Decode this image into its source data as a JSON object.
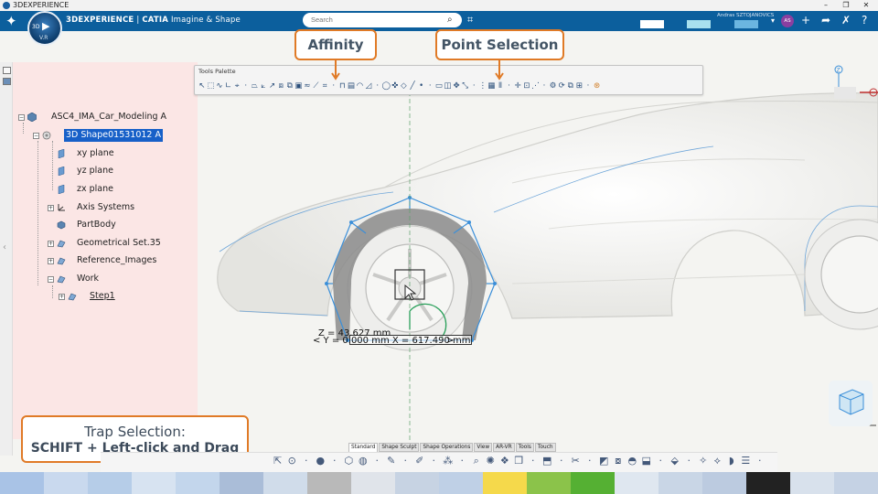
{
  "window": {
    "title": "3DEXPERIENCE",
    "controls": [
      "–",
      "❐",
      "✕"
    ]
  },
  "topbar": {
    "compass": {
      "label_3d": "3D",
      "version": "V.R"
    },
    "brand": "3DEXPERIENCE",
    "app": "CATIA",
    "module": "Imagine & Shape",
    "search_placeholder": "Search",
    "user": "Andras SZTOJANOVICS",
    "avatar_initials": "AS"
  },
  "tree": {
    "root": "ASC4_IMA_Car_Modeling A",
    "nodes": [
      {
        "label": "3D Shape01531012 A",
        "selected": true
      },
      {
        "label": "xy plane"
      },
      {
        "label": "yz plane"
      },
      {
        "label": "zx plane"
      },
      {
        "label": "Axis Systems"
      },
      {
        "label": "PartBody"
      },
      {
        "label": "Geometrical Set.35"
      },
      {
        "label": "Reference_Images"
      },
      {
        "label": "Work"
      },
      {
        "label": "Step1"
      }
    ]
  },
  "palette": {
    "title": "Tools Palette"
  },
  "callouts": {
    "affinity": "Affinity",
    "point_selection": "Point Selection",
    "trap_line1": "Trap Selection:",
    "trap_line2": "SCHIFT + Left-click and Drag"
  },
  "readout": {
    "z": "Z = 43.627 mm",
    "y": "< Y = 0.000 mm X = 617.490 mm",
    "arrow": ">"
  },
  "viewport": {
    "axis_label": "Z"
  },
  "tabs": [
    {
      "label": "Standard",
      "active": true
    },
    {
      "label": "Shape Sculpt"
    },
    {
      "label": "Shape Operations"
    },
    {
      "label": "View"
    },
    {
      "label": "AR-VR"
    },
    {
      "label": "Tools"
    },
    {
      "label": "Touch"
    }
  ],
  "colors": {
    "topbar": "#0c5f9d",
    "accent": "#e07a26",
    "wireframe": "#3b8fd9",
    "selection": "#1760c8",
    "bottom_strip": [
      "#a9c3e6",
      "#c9d9ee",
      "#b6cde8",
      "#d7e3f1",
      "#c3d6ec",
      "#aabdd8",
      "#d0dcea",
      "#b9b9b9",
      "#e0e4ea",
      "#c7d3e3",
      "#bfd0e6",
      "#f5d94b",
      "#8bc34a",
      "#55b033",
      "#dfe7f0",
      "#c9d6e6",
      "#bccbe0",
      "#222222",
      "#d8e1ec",
      "#c5d2e4"
    ]
  }
}
